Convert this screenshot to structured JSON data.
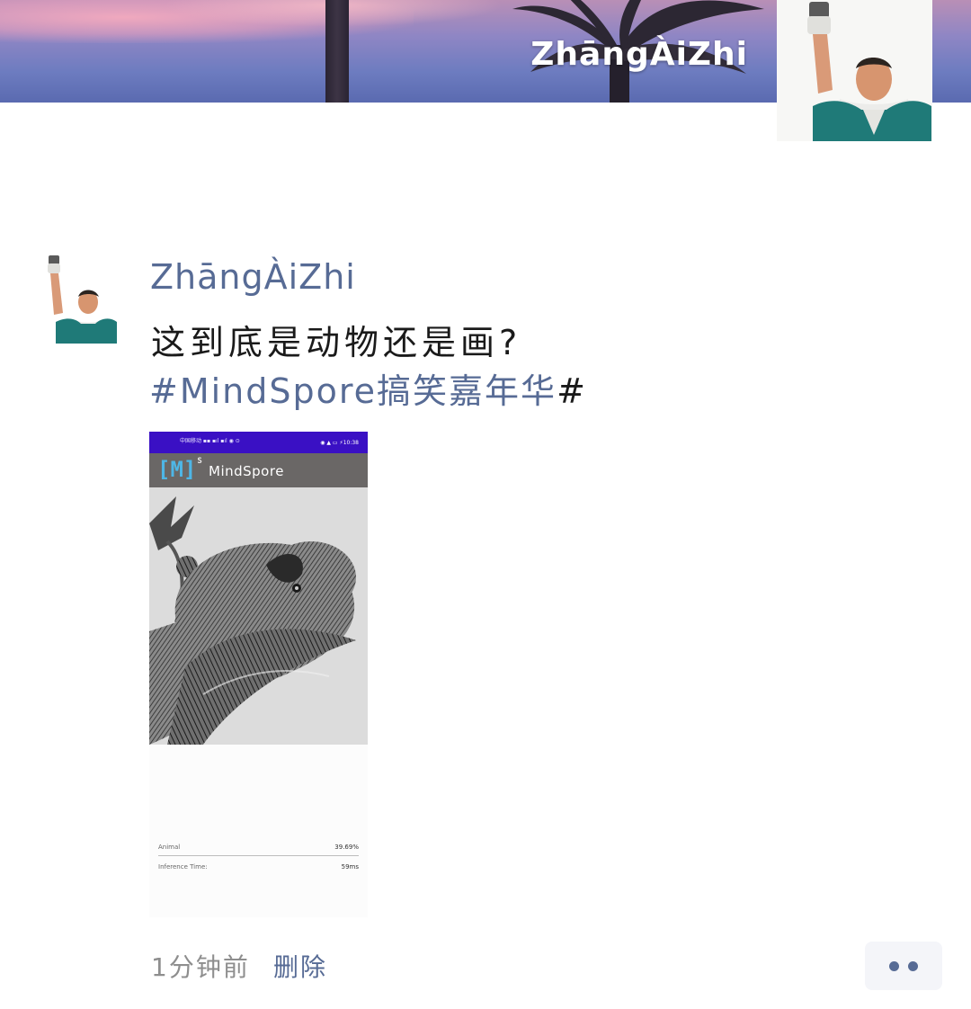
{
  "cover": {
    "name": "ZhāngÀiZhi"
  },
  "post": {
    "username": "ZhāngÀiZhi",
    "text": "这到底是动物还是画?",
    "hashtag": {
      "link": "#MindSpore搞笑嘉年华",
      "end": "#"
    },
    "screenshot": {
      "status_left": "中国移动 ▪▪ ▪ıl ▪ıl ◉ ⊙",
      "status_right": "◉ ▲ ▭ ⚡10:38",
      "logo": "[M]",
      "logo_sup": "S",
      "app_title": "MindSpore",
      "results": [
        {
          "label": "Animal",
          "value": "39.69%"
        },
        {
          "label": "Inference Time:",
          "value": "59ms"
        }
      ]
    },
    "time": "1分钟前",
    "delete_label": "删除"
  },
  "colors": {
    "link": "#576b95",
    "text": "#1a1a1a",
    "muted": "#8e8e8e",
    "statusbar": "#3a10c4"
  }
}
